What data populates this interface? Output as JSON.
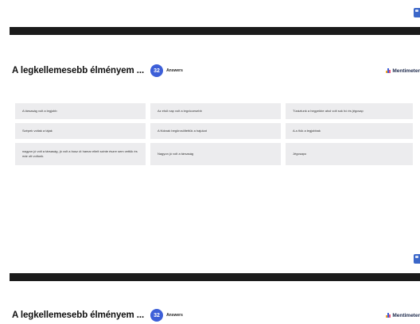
{
  "slide": {
    "title": "A legkellemesebb élményem ...",
    "answer_count": "32",
    "answers_label": "Answers",
    "brand": "Mentimeter"
  },
  "answers": [
    "A társaság volt a legjobb",
    "Az első nap volt a legviccesebb",
    "Túráztunk a hegyekbe ahol volt sok hó és jégcsap",
    "Szépek voltak a tájak",
    "A fiúknak begörcsöltettük a hajukat",
    "A-s fiúk a legjobbak",
    "nagyon jó volt a társaság, jó volt a busz út hamar eltelt szinte észre sem vettük és már ott voltunk.",
    "Nagyon jó volt a társaság",
    "Jégcsapo"
  ],
  "colors": {
    "accent": "#3d5fd8",
    "card_bg": "#ececee",
    "bar": "#1b1b1b"
  },
  "icons": {
    "brand": "mentimeter-bars-icon"
  }
}
